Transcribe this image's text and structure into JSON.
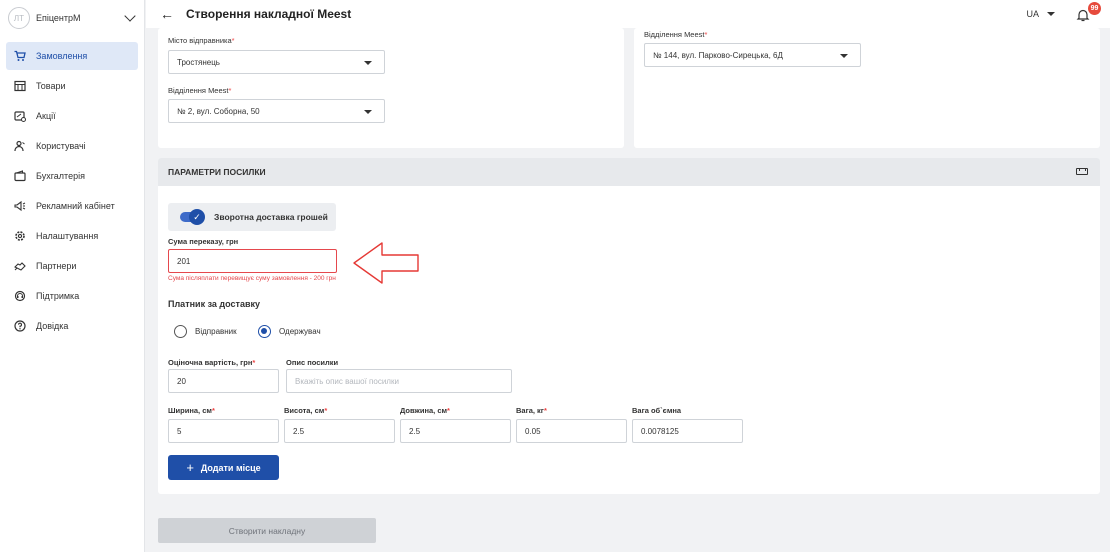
{
  "sidebar": {
    "avatar_initials": "ЛТ",
    "company": "ЕпіцентрМ",
    "items": [
      {
        "label": "Замовлення",
        "icon": "cart-icon",
        "active": true
      },
      {
        "label": "Товари",
        "icon": "store-icon",
        "active": false
      },
      {
        "label": "Акції",
        "icon": "promo-icon",
        "active": false
      },
      {
        "label": "Користувачі",
        "icon": "users-icon",
        "active": false
      },
      {
        "label": "Бухгалтерія",
        "icon": "wallet-icon",
        "active": false
      },
      {
        "label": "Рекламний кабінет",
        "icon": "megaphone-icon",
        "active": false
      },
      {
        "label": "Налаштування",
        "icon": "gear-icon",
        "active": false
      },
      {
        "label": "Партнери",
        "icon": "handshake-icon",
        "active": false
      },
      {
        "label": "Підтримка",
        "icon": "support-icon",
        "active": false
      },
      {
        "label": "Довідка",
        "icon": "help-icon",
        "active": false
      }
    ]
  },
  "header": {
    "title": "Створення накладної Meest",
    "language": "UA",
    "notifications_count": "99"
  },
  "sender": {
    "city_label": "Місто відправника",
    "city_value": "Тростянець",
    "branch_label": "Відділення Meest",
    "branch_value": "№ 2, вул. Соборна, 50"
  },
  "recipient": {
    "branch_label": "Відділення Meest",
    "branch_value": "№ 144, вул. Парково-Сирецька, 6Д"
  },
  "params": {
    "section_title": "ПАРАМЕТРИ ПОСИЛКИ",
    "cod_toggle_label": "Зворотна доставка грошей",
    "cod_enabled": true,
    "transfer_label": "Сума переказу, грн",
    "transfer_value": "201",
    "transfer_error": "Сума післяплати перевищує суму замовлення - 200 грн",
    "payer_title": "Платник за доставку",
    "payer_sender": "Відправник",
    "payer_recipient": "Одержувач",
    "payer_selected": "recipient",
    "declared_label": "Оціночна вартість, грн",
    "declared_value": "20",
    "description_label": "Опис посилки",
    "description_placeholder": "Вкажіть опис вашої посилки",
    "width_label": "Ширина, см",
    "width_value": "5",
    "height_label": "Висота, см",
    "height_value": "2.5",
    "length_label": "Довжина, см",
    "length_value": "2.5",
    "weight_label": "Вага, кг",
    "weight_value": "0.05",
    "volume_label": "Вага об`ємна",
    "volume_value": "0.0078125",
    "add_place_label": "Додати місце"
  },
  "footer": {
    "create_label": "Створити накладну"
  },
  "colors": {
    "accent": "#1f4fa8",
    "error": "#e5484d",
    "badge": "#e64a3c"
  }
}
